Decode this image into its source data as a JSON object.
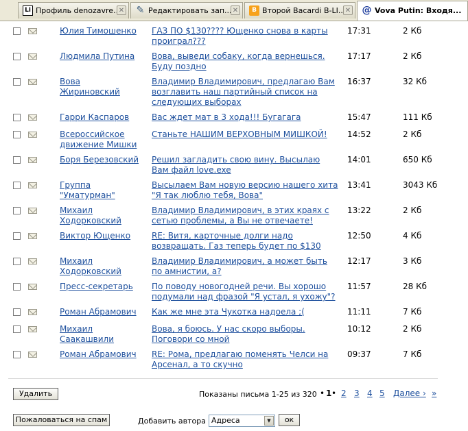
{
  "tabs": [
    {
      "title": "Профиль denozavre...",
      "favicon": "li-icon"
    },
    {
      "title": "Редактировать зап...",
      "favicon": "pencil-icon"
    },
    {
      "title": "Второй Bacardi B-LI...",
      "favicon": "bacardi-icon"
    },
    {
      "title": "Vova Putin: Входя...",
      "favicon": "at-icon"
    }
  ],
  "messages": [
    {
      "sender": "Юлия Тимошенко",
      "subject": "ГАЗ ПО $130???? Ющенко снова в карты проиграл???",
      "time": "17:31",
      "size": "2 Кб"
    },
    {
      "sender": "Людмила Путина",
      "subject": "Вова, выведи собаку, когда вернешься. Буду поздно",
      "time": "17:17",
      "size": "2 Кб"
    },
    {
      "sender": "Вова Жириновский",
      "subject": "Владимир Владимирович, предлагаю Вам возглавить наш партийный список на следующих выборах",
      "time": "16:37",
      "size": "32 Кб"
    },
    {
      "sender": "Гарри Каспаров",
      "subject": "Вас ждет мат в 3 хода!!! Бугагага",
      "time": "15:47",
      "size": "111 Кб"
    },
    {
      "sender": "Всероссийское движение Мишки",
      "subject": "Станьте НАШИМ ВЕРХОВНЫМ МИШКОЙ!",
      "time": "14:52",
      "size": "2 Кб"
    },
    {
      "sender": "Боря Березовский",
      "subject": "Решил загладить свою вину. Высылаю Вам файл love.exe",
      "time": "14:01",
      "size": "650 Кб"
    },
    {
      "sender": "Группа \"Уматурман\"",
      "subject": "Высылаем Вам новую версию нашего хита \"Я так люблю тебя, Вова\"",
      "time": "13:41",
      "size": "3043 Кб"
    },
    {
      "sender": "Михаил Ходорковский",
      "subject": "Владимир Владимирович, в этих краях с сетью проблемы, а Вы не отвечаете!",
      "time": "13:22",
      "size": "2 Кб"
    },
    {
      "sender": "Виктор Ющенко",
      "subject": "RE: Витя, карточные долги надо возвращать. Газ теперь будет по $130",
      "time": "12:50",
      "size": "4 Кб"
    },
    {
      "sender": "Михаил Ходорковский",
      "subject": "Владимир Владимирович, а может быть по амнистии, а?",
      "time": "12:17",
      "size": "3 Кб"
    },
    {
      "sender": "Пресс-секретарь",
      "subject": "По поводу новогодней речи. Вы хорошо подумали над фразой \"Я устал, я ухожу\"?",
      "time": "11:57",
      "size": "28 Кб"
    },
    {
      "sender": "Роман Абрамович",
      "subject": "Как же мне эта Чукотка надоела ;(",
      "time": "11:11",
      "size": "7 Кб"
    },
    {
      "sender": "Михаил Саакашвили",
      "subject": "Вова, я боюсь. У нас скоро выборы. Поговори со мной",
      "time": "10:12",
      "size": "2 Кб"
    },
    {
      "sender": "Роман Абрамович",
      "subject": "RE: Рома, предлагаю поменять Челси на Арсенал, а то скучно",
      "time": "09:37",
      "size": "7 Кб"
    }
  ],
  "actions": {
    "delete_label": "Удалить",
    "spam_label": "Пожаловаться на спам",
    "add_author_label": "Добавить автора в",
    "folder_selected": "Адреса",
    "ok_label": "ок"
  },
  "pagination": {
    "shown_text": "Показаны письма 1-25 из 320",
    "bullet": "•",
    "current": "1",
    "pages": [
      "2",
      "3",
      "4",
      "5"
    ],
    "next_label": "Далее ›",
    "last_label": "»"
  }
}
